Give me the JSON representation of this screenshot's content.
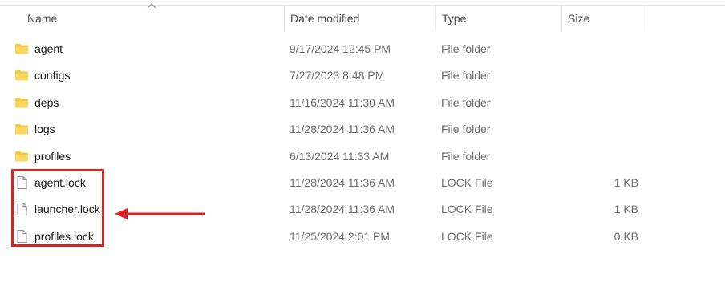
{
  "columns": {
    "name": "Name",
    "date_modified": "Date modified",
    "type": "Type",
    "size": "Size"
  },
  "files": [
    {
      "name": "agent",
      "date": "9/17/2024 12:45 PM",
      "type": "File folder",
      "size": "",
      "icon": "folder-icon"
    },
    {
      "name": "configs",
      "date": "7/27/2023 8:48 PM",
      "type": "File folder",
      "size": "",
      "icon": "folder-icon"
    },
    {
      "name": "deps",
      "date": "11/16/2024 11:30 AM",
      "type": "File folder",
      "size": "",
      "icon": "folder-icon"
    },
    {
      "name": "logs",
      "date": "11/28/2024 11:36 AM",
      "type": "File folder",
      "size": "",
      "icon": "folder-icon"
    },
    {
      "name": "profiles",
      "date": "6/13/2024 11:33 AM",
      "type": "File folder",
      "size": "",
      "icon": "folder-icon"
    },
    {
      "name": "agent.lock",
      "date": "11/28/2024 11:36 AM",
      "type": "LOCK File",
      "size": "1 KB",
      "icon": "file-icon"
    },
    {
      "name": "launcher.lock",
      "date": "11/28/2024 11:36 AM",
      "type": "LOCK File",
      "size": "1 KB",
      "icon": "file-icon"
    },
    {
      "name": "profiles.lock",
      "date": "11/25/2024 2:01 PM",
      "type": "LOCK File",
      "size": "0 KB",
      "icon": "file-icon"
    }
  ],
  "colors": {
    "folder": "#f8c43a",
    "annotation": "#e02020"
  }
}
